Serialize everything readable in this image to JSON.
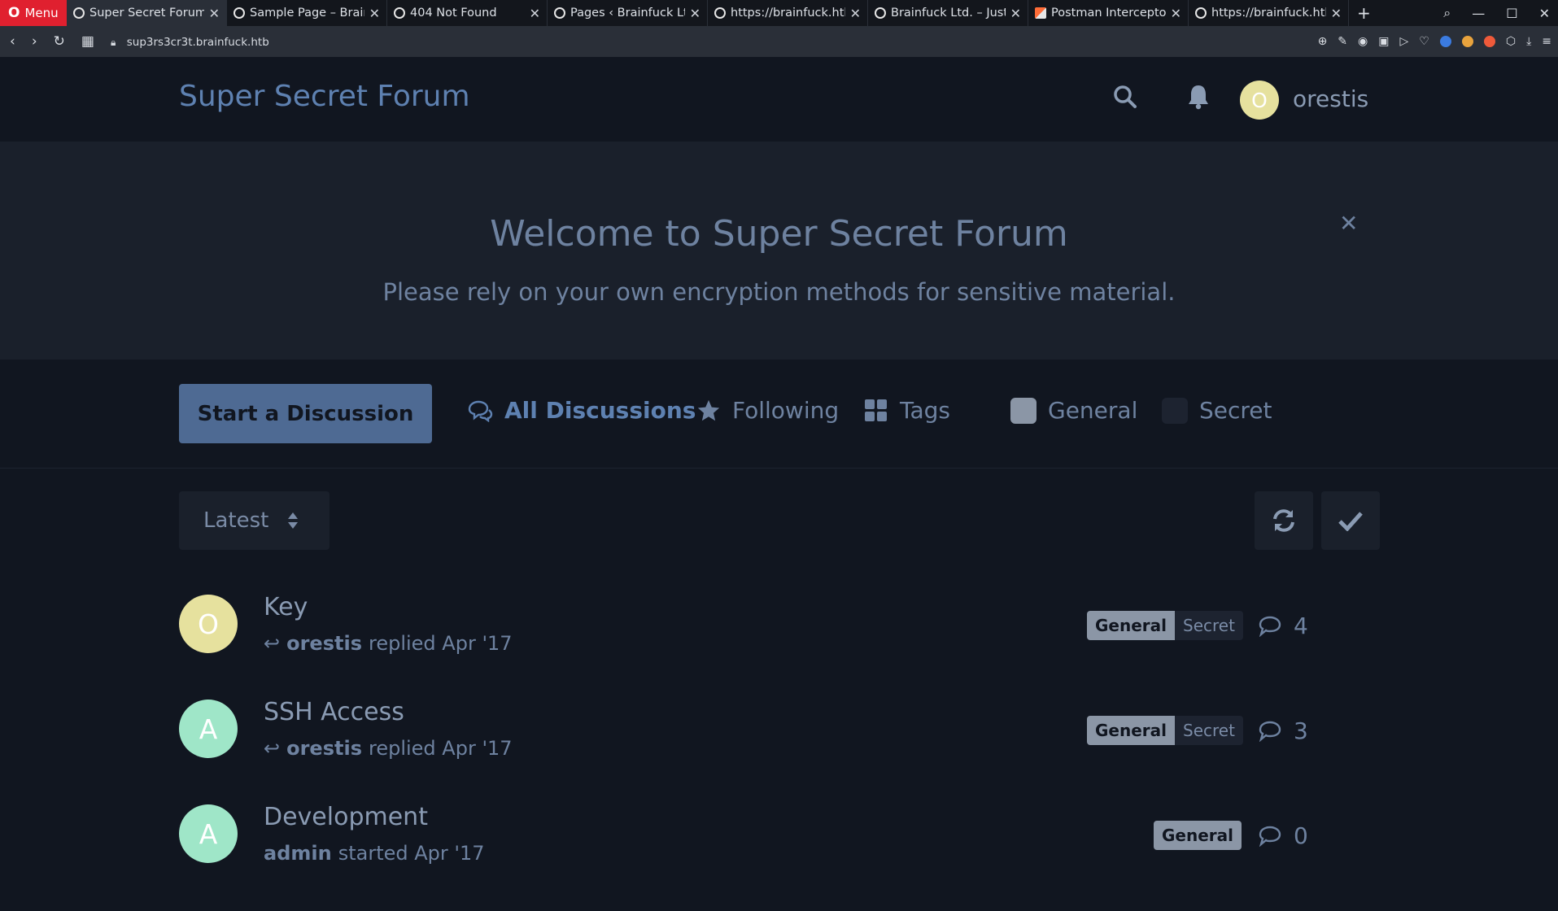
{
  "browser": {
    "menu_label": "Menu",
    "tabs": [
      {
        "title": "Super Secret Forum",
        "active": true
      },
      {
        "title": "Sample Page – Brainfuck",
        "active": false
      },
      {
        "title": "404 Not Found",
        "active": false
      },
      {
        "title": "Pages ‹ Brainfuck Ltd.",
        "active": false
      },
      {
        "title": "https://brainfuck.htb/",
        "active": false
      },
      {
        "title": "Brainfuck Ltd. – Just a",
        "active": false
      },
      {
        "title": "Postman Interceptor",
        "active": false
      },
      {
        "title": "https://brainfuck.htb/",
        "active": false
      }
    ],
    "url": "sup3rs3cr3t.brainfuck.htb"
  },
  "forum": {
    "title": "Super Secret Forum",
    "user": {
      "name": "orestis",
      "initial": "O",
      "color": "#e6e19e"
    }
  },
  "hero": {
    "title": "Welcome to Super Secret Forum",
    "subtitle": "Please rely on your own encryption methods for sensitive material."
  },
  "nav": {
    "start_label": "Start a Discussion",
    "all_label": "All Discussions",
    "following_label": "Following",
    "tags_label": "Tags",
    "general_label": "General",
    "secret_label": "Secret",
    "general_color": "#8b96a6",
    "secret_color": "#1d2330"
  },
  "toolbar": {
    "sort_label": "Latest"
  },
  "discussions": [
    {
      "title": "Key",
      "initial": "O",
      "avatar_color": "#e6e19e",
      "user": "orestis",
      "action": "replied Apr '17",
      "replied": true,
      "tags": [
        "General",
        "Secret"
      ],
      "count": "4"
    },
    {
      "title": "SSH Access",
      "initial": "A",
      "avatar_color": "#9fe6c8",
      "user": "orestis",
      "action": "replied Apr '17",
      "replied": true,
      "tags": [
        "General",
        "Secret"
      ],
      "count": "3"
    },
    {
      "title": "Development",
      "initial": "A",
      "avatar_color": "#9fe6c8",
      "user": "admin",
      "action": "started Apr '17",
      "replied": false,
      "tags": [
        "General"
      ],
      "count": "0"
    }
  ],
  "colors": {
    "accent": "#5e81b1",
    "background": "#111620",
    "hero_bg": "#1a202b"
  }
}
